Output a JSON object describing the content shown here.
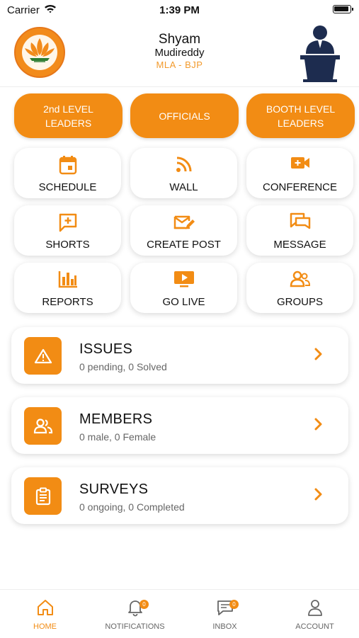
{
  "status_bar": {
    "carrier": "Carrier",
    "time": "1:39 PM"
  },
  "header": {
    "first_name": "Shyam",
    "last_name": "Mudireddy",
    "role": "MLA - BJP",
    "logo_text": "BJP"
  },
  "top_buttons": [
    {
      "label": "2nd LEVEL LEADERS"
    },
    {
      "label": "OFFICIALS"
    },
    {
      "label": "BOOTH LEVEL LEADERS"
    }
  ],
  "tiles": [
    {
      "label": "SCHEDULE",
      "icon": "calendar-icon"
    },
    {
      "label": "WALL",
      "icon": "rss-icon"
    },
    {
      "label": "CONFERENCE",
      "icon": "video-icon"
    },
    {
      "label": "SHORTS",
      "icon": "add-comment-icon"
    },
    {
      "label": "CREATE POST",
      "icon": "compose-mail-icon"
    },
    {
      "label": "MESSAGE",
      "icon": "chat-icon"
    },
    {
      "label": "REPORTS",
      "icon": "bar-chart-icon"
    },
    {
      "label": "GO LIVE",
      "icon": "live-tv-icon"
    },
    {
      "label": "GROUPS",
      "icon": "groups-icon"
    }
  ],
  "cards": [
    {
      "title": "ISSUES",
      "subtitle": "0 pending, 0 Solved",
      "icon": "warning-icon"
    },
    {
      "title": "MEMBERS",
      "subtitle": "0 male, 0 Female",
      "icon": "people-icon"
    },
    {
      "title": "SURVEYS",
      "subtitle": "0 ongoing, 0 Completed",
      "icon": "clipboard-icon"
    }
  ],
  "bottom_nav": [
    {
      "label": "HOME",
      "icon": "home-icon",
      "active": true
    },
    {
      "label": "NOTIFICATIONS",
      "icon": "bell-icon",
      "badge": "0"
    },
    {
      "label": "INBOX",
      "icon": "inbox-chat-icon",
      "badge": "0"
    },
    {
      "label": "ACCOUNT",
      "icon": "person-icon"
    }
  ],
  "colors": {
    "accent": "#F28C14",
    "text": "#111111",
    "muted": "#666666"
  }
}
